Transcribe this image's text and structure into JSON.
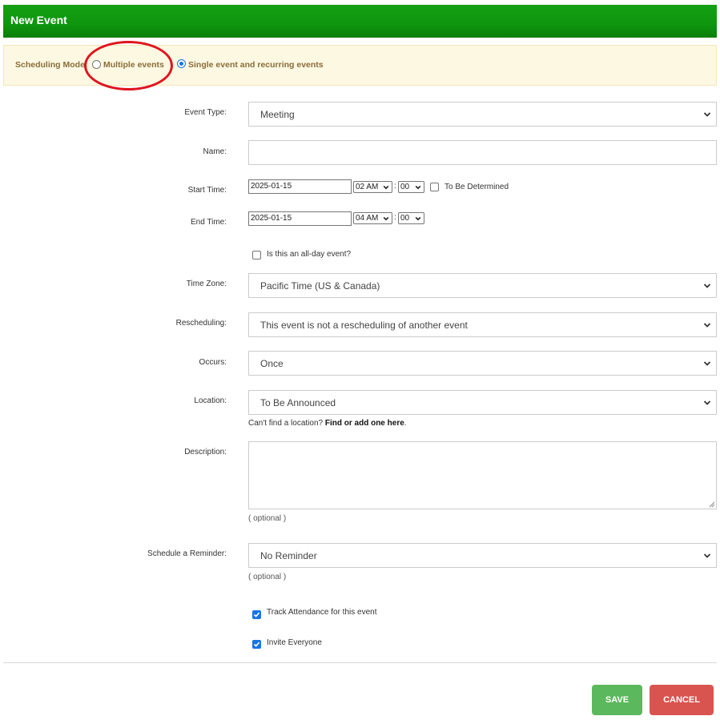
{
  "header": {
    "title": "New Event"
  },
  "scheduling_mode": {
    "label": "Scheduling Mode:",
    "options": [
      {
        "label": "Multiple events",
        "selected": false
      },
      {
        "label": "Single event and recurring events",
        "selected": true
      }
    ],
    "highlight_color": "#e0141e"
  },
  "form": {
    "event_type": {
      "label": "Event Type:",
      "value": "Meeting"
    },
    "name": {
      "label": "Name:",
      "value": ""
    },
    "start_time": {
      "label": "Start Time:",
      "date": "2025-01-15",
      "hour": "02 AM",
      "minute": "00",
      "colon": ":",
      "tbd_label": "To Be Determined",
      "tbd_checked": false
    },
    "end_time": {
      "label": "End Time:",
      "date": "2025-01-15",
      "hour": "04 AM",
      "minute": "00",
      "colon": ":"
    },
    "all_day": {
      "label": "Is this an all-day event?",
      "checked": false
    },
    "time_zone": {
      "label": "Time Zone:",
      "value": "Pacific Time (US & Canada)"
    },
    "rescheduling": {
      "label": "Rescheduling:",
      "value": "This event is not a rescheduling of another event"
    },
    "occurs": {
      "label": "Occurs:",
      "value": "Once"
    },
    "location": {
      "label": "Location:",
      "value": "To Be Announced",
      "help_prefix": "Can't find a location?",
      "help_link": "Find or add one here",
      "help_suffix": "."
    },
    "description": {
      "label": "Description:",
      "value": "",
      "hint": "( optional )"
    },
    "reminder": {
      "label": "Schedule a Reminder:",
      "value": "No Reminder",
      "hint": "( optional )"
    },
    "track_attendance": {
      "label": "Track Attendance for this event",
      "checked": true
    },
    "invite_everyone": {
      "label": "Invite Everyone",
      "checked": true
    }
  },
  "actions": {
    "save_label": "SAVE",
    "cancel_label": "CANCEL"
  },
  "colors": {
    "header_green": "#0e960e",
    "mode_bar_bg": "#fdf8e2",
    "mode_text": "#8a6d3b",
    "save_green": "#5cb85c",
    "cancel_red": "#d9534f",
    "checkbox_blue": "#1a73e8"
  },
  "icons": {
    "select_arrow": "chevron-down-icon",
    "checkbox_check": "checkmark-icon",
    "textarea_resize": "resize-grip-icon"
  }
}
